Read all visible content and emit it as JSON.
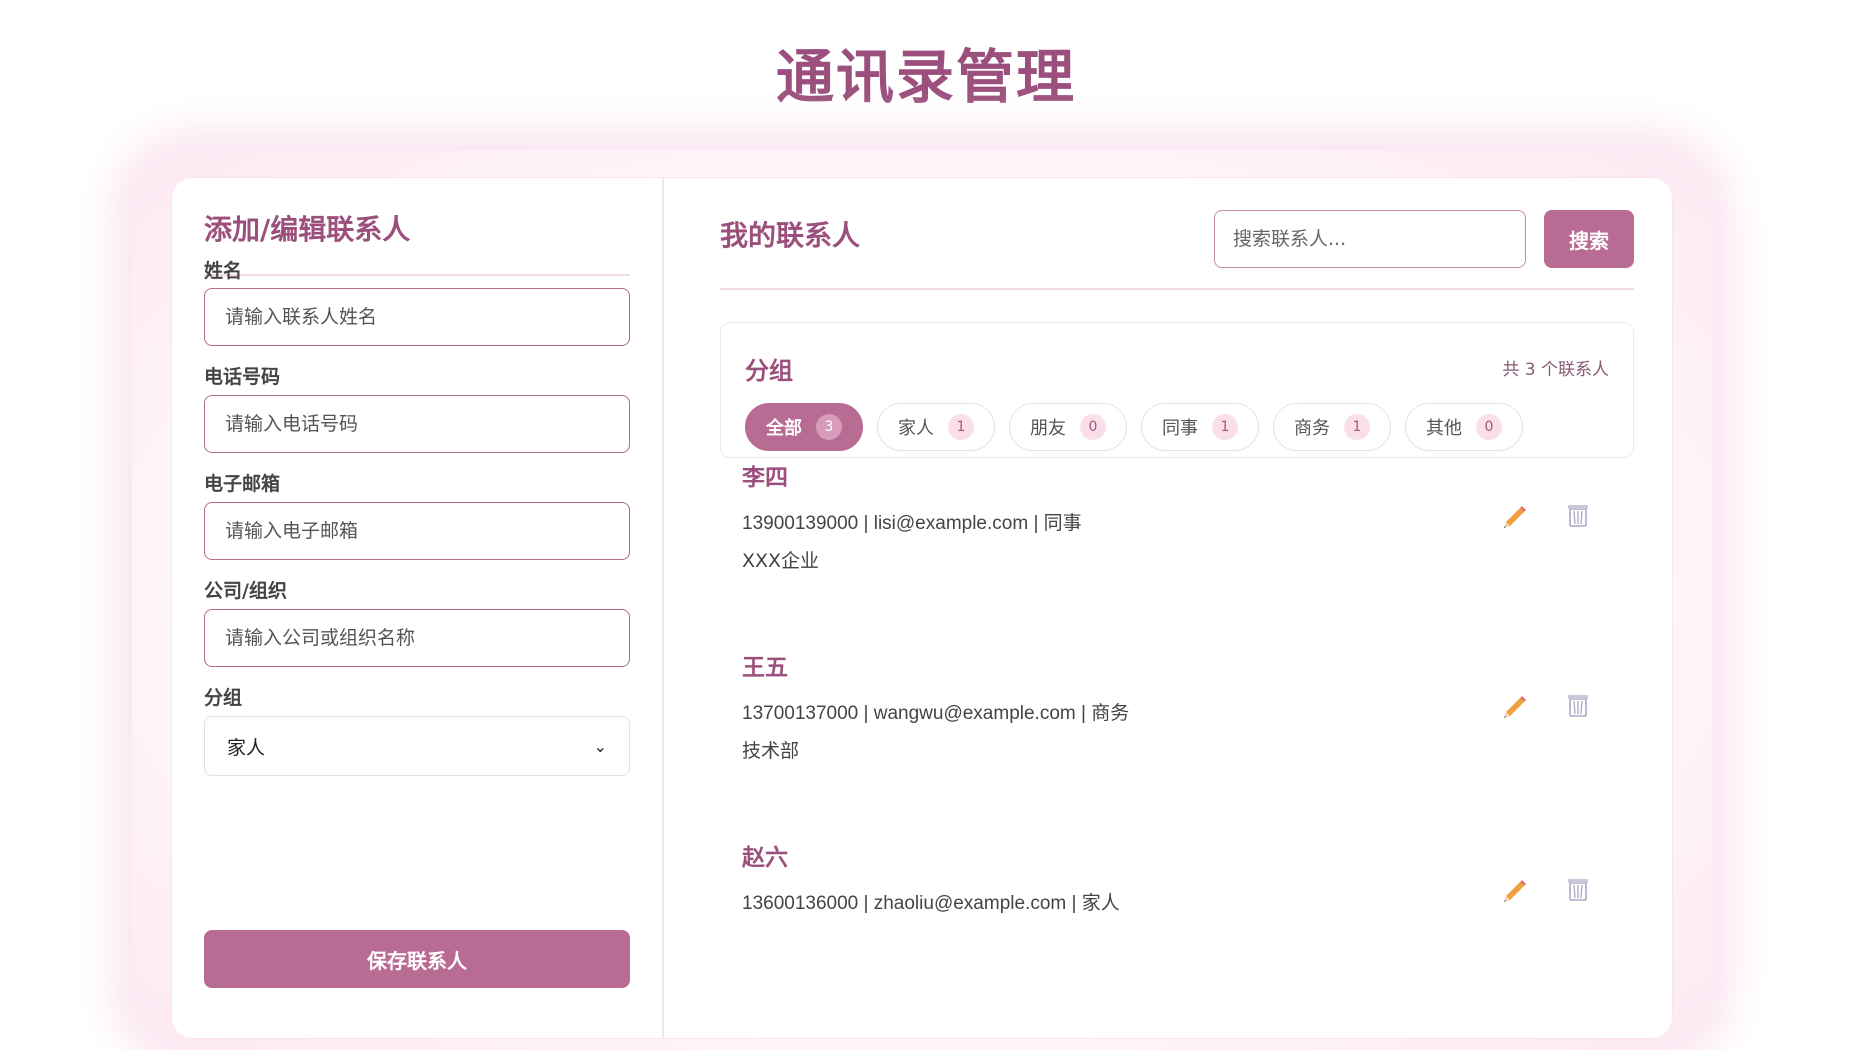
{
  "page": {
    "title": "通讯录管理"
  },
  "form": {
    "title": "添加/编辑联系人",
    "name_label": "姓名",
    "name_placeholder": "请输入联系人姓名",
    "phone_label": "电话号码",
    "phone_placeholder": "请输入电话号码",
    "email_label": "电子邮箱",
    "email_placeholder": "请输入电子邮箱",
    "company_label": "公司/组织",
    "company_placeholder": "请输入公司或组织名称",
    "group_label": "分组",
    "group_selected": "家人",
    "save_label": "保存联系人"
  },
  "contacts_panel": {
    "title": "我的联系人",
    "search_placeholder": "搜索联系人...",
    "search_label": "搜索",
    "groups_title": "分组",
    "total_text": "共 3 个联系人",
    "groups": [
      {
        "label": "全部",
        "count": "3",
        "active": true
      },
      {
        "label": "家人",
        "count": "1"
      },
      {
        "label": "朋友",
        "count": "0"
      },
      {
        "label": "同事",
        "count": "1"
      },
      {
        "label": "商务",
        "count": "1"
      },
      {
        "label": "其他",
        "count": "0"
      }
    ],
    "contacts": [
      {
        "name": "李四",
        "info": "13900139000 | lisi@example.com | 同事",
        "org": "XXX企业"
      },
      {
        "name": "王五",
        "info": "13700137000 | wangwu@example.com | 商务",
        "org": "技术部"
      },
      {
        "name": "赵六",
        "info": "13600136000 | zhaoliu@example.com | 家人",
        "org": ""
      }
    ]
  },
  "colors": {
    "accent": "#b86b93",
    "title": "#9b4f7c"
  }
}
